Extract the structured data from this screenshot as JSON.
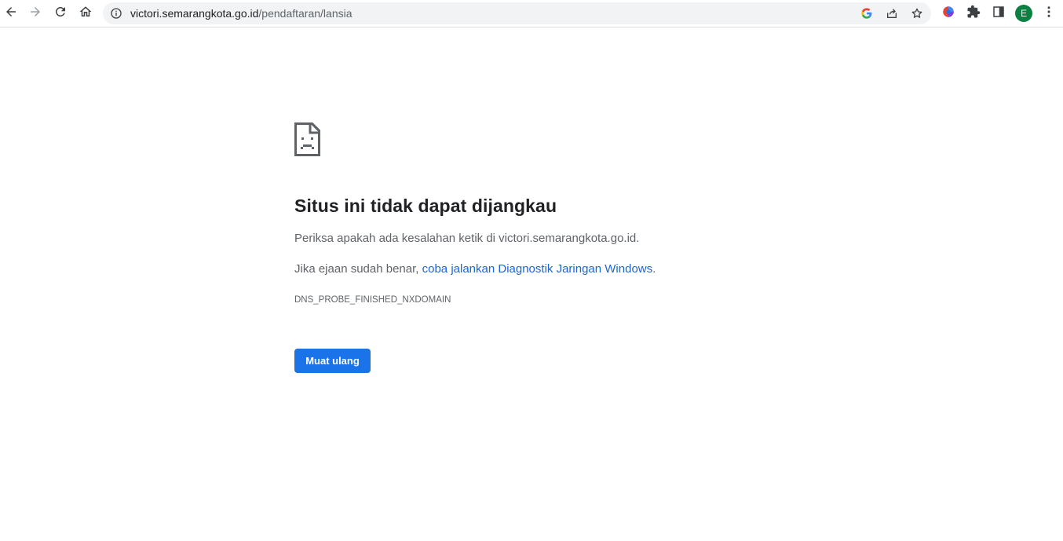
{
  "toolbar": {
    "url_host": "victori.semarangkota.go.id",
    "url_path": "/pendaftaran/lansia",
    "profile_initial": "E",
    "icons": {
      "back": "back-arrow-icon",
      "forward": "forward-arrow-icon",
      "reload": "reload-icon",
      "home": "home-icon",
      "site_info": "info-icon",
      "google_lens": "google-icon",
      "share": "share-icon",
      "bookmark": "star-icon",
      "extension_colorful": "extension-colorful-icon",
      "extensions": "puzzle-icon",
      "side_panel": "side-panel-icon",
      "menu": "kebab-menu-icon"
    },
    "colors": {
      "avatar_bg": "#0b8043",
      "omnibox_bg": "#f1f3f4"
    }
  },
  "error": {
    "title": "Situs ini tidak dapat dijangkau",
    "message1": "Periksa apakah ada kesalahan ketik di victori.semarangkota.go.id.",
    "message2_prefix": "Jika ejaan sudah benar, ",
    "message2_link": "coba jalankan Diagnostik Jaringan Windows",
    "message2_suffix": ".",
    "error_code": "DNS_PROBE_FINISHED_NXDOMAIN",
    "reload_label": "Muat ulang",
    "icon": "sad-page-icon",
    "colors": {
      "link": "#1967d2",
      "button_bg": "#1a73e8"
    }
  }
}
